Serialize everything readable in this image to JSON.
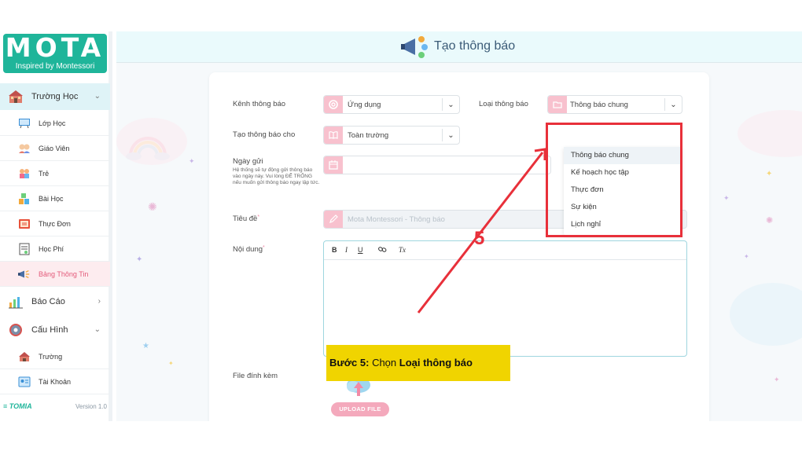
{
  "logo": {
    "title": "MOTA",
    "tagline": "Inspired by Montessori"
  },
  "sidebar": {
    "groups": [
      {
        "label": "Trường Học",
        "chevron": "⌄"
      },
      {
        "label": "Báo Cáo",
        "chevron": "›"
      },
      {
        "label": "Cấu Hình",
        "chevron": "⌄"
      }
    ],
    "items": [
      {
        "label": "Lớp Học"
      },
      {
        "label": "Giáo Viên"
      },
      {
        "label": "Trẻ"
      },
      {
        "label": "Bài Học"
      },
      {
        "label": "Thực Đơn"
      },
      {
        "label": "Học Phí"
      },
      {
        "label": "Bảng Thông Tin"
      },
      {
        "label": "Trường"
      },
      {
        "label": "Tài Khoản"
      }
    ],
    "footer": {
      "brand": "TOMIA",
      "version": "Version 1.0"
    }
  },
  "header": {
    "title": "Tạo thông báo"
  },
  "form": {
    "kenh": {
      "label": "Kênh thông báo",
      "value": "Ứng dụng"
    },
    "loai": {
      "label": "Loại thông báo",
      "value": "Thông báo chung"
    },
    "tao_cho": {
      "label": "Tạo thông báo cho",
      "value": "Toàn trường"
    },
    "ngay_gui": {
      "label": "Ngày gửi",
      "hint": "Hệ thống sẽ tự động gửi thông báo vào ngày này. Vui lòng ĐỂ TRỐNG nếu muốn gửi thông báo ngay lập tức.",
      "value": ""
    },
    "tieu_de": {
      "label": "Tiêu đề",
      "required_mark": "*",
      "placeholder": "Mota Montessori - Thông báo"
    },
    "noi_dung": {
      "label": "Nội dung",
      "required_mark": "*",
      "toolbar": {
        "bold": "B",
        "italic": "I",
        "underline": "U",
        "clear": "Tx"
      }
    },
    "file": {
      "label": "File đính kèm",
      "upload_label": "UPLOAD FILE"
    }
  },
  "dropdown": {
    "options": [
      "Thông báo chung",
      "Kế hoạch học tập",
      "Thực đơn",
      "Sự kiện",
      "Lịch nghỉ"
    ],
    "selected": "Thông báo chung"
  },
  "annotation": {
    "step_number": "5",
    "step_prefix": "Bước 5:",
    "step_text": " Chọn ",
    "step_bold": "Loại thông báo",
    "colors": {
      "highlight": "#e8303a",
      "label_bg": "#f0d400"
    }
  },
  "colors": {
    "brand": "#1fb59a",
    "accent_pink": "#f8c1ce",
    "active_bg": "#dff3f7"
  }
}
